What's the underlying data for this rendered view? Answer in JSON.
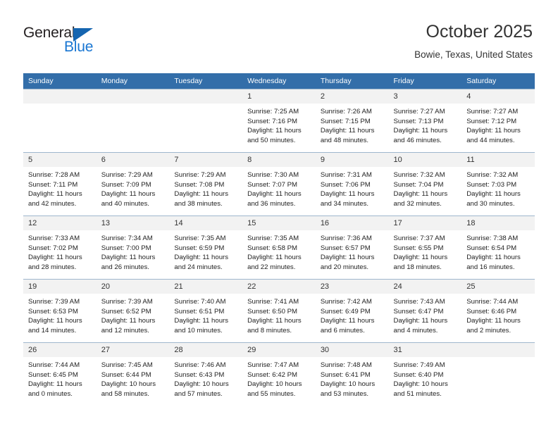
{
  "brand": {
    "name_top": "General",
    "name_bottom": "Blue",
    "triangle_color": "#1565b0",
    "blue_color": "#1976d2"
  },
  "header": {
    "month_title": "October 2025",
    "location": "Bowie, Texas, United States"
  },
  "theme": {
    "header_row_bg": "#336ea9",
    "header_row_text": "#ffffff",
    "daynum_bg": "#f2f2f2",
    "cell_border": "#9fb6cd",
    "body_text": "#222222"
  },
  "calendar": {
    "weekday_headers": [
      "Sunday",
      "Monday",
      "Tuesday",
      "Wednesday",
      "Thursday",
      "Friday",
      "Saturday"
    ],
    "weeks": [
      [
        {
          "day": "",
          "empty": true
        },
        {
          "day": "",
          "empty": true
        },
        {
          "day": "",
          "empty": true
        },
        {
          "day": "1",
          "sunrise": "Sunrise: 7:25 AM",
          "sunset": "Sunset: 7:16 PM",
          "daylight1": "Daylight: 11 hours",
          "daylight2": "and 50 minutes."
        },
        {
          "day": "2",
          "sunrise": "Sunrise: 7:26 AM",
          "sunset": "Sunset: 7:15 PM",
          "daylight1": "Daylight: 11 hours",
          "daylight2": "and 48 minutes."
        },
        {
          "day": "3",
          "sunrise": "Sunrise: 7:27 AM",
          "sunset": "Sunset: 7:13 PM",
          "daylight1": "Daylight: 11 hours",
          "daylight2": "and 46 minutes."
        },
        {
          "day": "4",
          "sunrise": "Sunrise: 7:27 AM",
          "sunset": "Sunset: 7:12 PM",
          "daylight1": "Daylight: 11 hours",
          "daylight2": "and 44 minutes."
        }
      ],
      [
        {
          "day": "5",
          "sunrise": "Sunrise: 7:28 AM",
          "sunset": "Sunset: 7:11 PM",
          "daylight1": "Daylight: 11 hours",
          "daylight2": "and 42 minutes."
        },
        {
          "day": "6",
          "sunrise": "Sunrise: 7:29 AM",
          "sunset": "Sunset: 7:09 PM",
          "daylight1": "Daylight: 11 hours",
          "daylight2": "and 40 minutes."
        },
        {
          "day": "7",
          "sunrise": "Sunrise: 7:29 AM",
          "sunset": "Sunset: 7:08 PM",
          "daylight1": "Daylight: 11 hours",
          "daylight2": "and 38 minutes."
        },
        {
          "day": "8",
          "sunrise": "Sunrise: 7:30 AM",
          "sunset": "Sunset: 7:07 PM",
          "daylight1": "Daylight: 11 hours",
          "daylight2": "and 36 minutes."
        },
        {
          "day": "9",
          "sunrise": "Sunrise: 7:31 AM",
          "sunset": "Sunset: 7:06 PM",
          "daylight1": "Daylight: 11 hours",
          "daylight2": "and 34 minutes."
        },
        {
          "day": "10",
          "sunrise": "Sunrise: 7:32 AM",
          "sunset": "Sunset: 7:04 PM",
          "daylight1": "Daylight: 11 hours",
          "daylight2": "and 32 minutes."
        },
        {
          "day": "11",
          "sunrise": "Sunrise: 7:32 AM",
          "sunset": "Sunset: 7:03 PM",
          "daylight1": "Daylight: 11 hours",
          "daylight2": "and 30 minutes."
        }
      ],
      [
        {
          "day": "12",
          "sunrise": "Sunrise: 7:33 AM",
          "sunset": "Sunset: 7:02 PM",
          "daylight1": "Daylight: 11 hours",
          "daylight2": "and 28 minutes."
        },
        {
          "day": "13",
          "sunrise": "Sunrise: 7:34 AM",
          "sunset": "Sunset: 7:00 PM",
          "daylight1": "Daylight: 11 hours",
          "daylight2": "and 26 minutes."
        },
        {
          "day": "14",
          "sunrise": "Sunrise: 7:35 AM",
          "sunset": "Sunset: 6:59 PM",
          "daylight1": "Daylight: 11 hours",
          "daylight2": "and 24 minutes."
        },
        {
          "day": "15",
          "sunrise": "Sunrise: 7:35 AM",
          "sunset": "Sunset: 6:58 PM",
          "daylight1": "Daylight: 11 hours",
          "daylight2": "and 22 minutes."
        },
        {
          "day": "16",
          "sunrise": "Sunrise: 7:36 AM",
          "sunset": "Sunset: 6:57 PM",
          "daylight1": "Daylight: 11 hours",
          "daylight2": "and 20 minutes."
        },
        {
          "day": "17",
          "sunrise": "Sunrise: 7:37 AM",
          "sunset": "Sunset: 6:55 PM",
          "daylight1": "Daylight: 11 hours",
          "daylight2": "and 18 minutes."
        },
        {
          "day": "18",
          "sunrise": "Sunrise: 7:38 AM",
          "sunset": "Sunset: 6:54 PM",
          "daylight1": "Daylight: 11 hours",
          "daylight2": "and 16 minutes."
        }
      ],
      [
        {
          "day": "19",
          "sunrise": "Sunrise: 7:39 AM",
          "sunset": "Sunset: 6:53 PM",
          "daylight1": "Daylight: 11 hours",
          "daylight2": "and 14 minutes."
        },
        {
          "day": "20",
          "sunrise": "Sunrise: 7:39 AM",
          "sunset": "Sunset: 6:52 PM",
          "daylight1": "Daylight: 11 hours",
          "daylight2": "and 12 minutes."
        },
        {
          "day": "21",
          "sunrise": "Sunrise: 7:40 AM",
          "sunset": "Sunset: 6:51 PM",
          "daylight1": "Daylight: 11 hours",
          "daylight2": "and 10 minutes."
        },
        {
          "day": "22",
          "sunrise": "Sunrise: 7:41 AM",
          "sunset": "Sunset: 6:50 PM",
          "daylight1": "Daylight: 11 hours",
          "daylight2": "and 8 minutes."
        },
        {
          "day": "23",
          "sunrise": "Sunrise: 7:42 AM",
          "sunset": "Sunset: 6:49 PM",
          "daylight1": "Daylight: 11 hours",
          "daylight2": "and 6 minutes."
        },
        {
          "day": "24",
          "sunrise": "Sunrise: 7:43 AM",
          "sunset": "Sunset: 6:47 PM",
          "daylight1": "Daylight: 11 hours",
          "daylight2": "and 4 minutes."
        },
        {
          "day": "25",
          "sunrise": "Sunrise: 7:44 AM",
          "sunset": "Sunset: 6:46 PM",
          "daylight1": "Daylight: 11 hours",
          "daylight2": "and 2 minutes."
        }
      ],
      [
        {
          "day": "26",
          "sunrise": "Sunrise: 7:44 AM",
          "sunset": "Sunset: 6:45 PM",
          "daylight1": "Daylight: 11 hours",
          "daylight2": "and 0 minutes."
        },
        {
          "day": "27",
          "sunrise": "Sunrise: 7:45 AM",
          "sunset": "Sunset: 6:44 PM",
          "daylight1": "Daylight: 10 hours",
          "daylight2": "and 58 minutes."
        },
        {
          "day": "28",
          "sunrise": "Sunrise: 7:46 AM",
          "sunset": "Sunset: 6:43 PM",
          "daylight1": "Daylight: 10 hours",
          "daylight2": "and 57 minutes."
        },
        {
          "day": "29",
          "sunrise": "Sunrise: 7:47 AM",
          "sunset": "Sunset: 6:42 PM",
          "daylight1": "Daylight: 10 hours",
          "daylight2": "and 55 minutes."
        },
        {
          "day": "30",
          "sunrise": "Sunrise: 7:48 AM",
          "sunset": "Sunset: 6:41 PM",
          "daylight1": "Daylight: 10 hours",
          "daylight2": "and 53 minutes."
        },
        {
          "day": "31",
          "sunrise": "Sunrise: 7:49 AM",
          "sunset": "Sunset: 6:40 PM",
          "daylight1": "Daylight: 10 hours",
          "daylight2": "and 51 minutes."
        },
        {
          "day": "",
          "empty": true
        }
      ]
    ]
  }
}
